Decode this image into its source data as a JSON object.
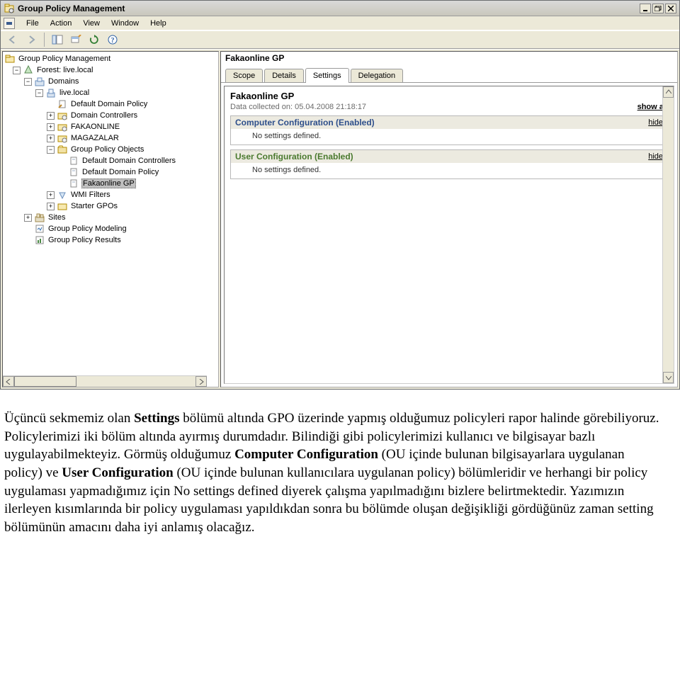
{
  "window": {
    "title": "Group Policy Management"
  },
  "menubar": [
    "File",
    "Action",
    "View",
    "Window",
    "Help"
  ],
  "tree": {
    "root": "Group Policy Management",
    "forest": "Forest: live.local",
    "domains": "Domains",
    "domain": "live.local",
    "items": [
      "Default Domain Policy",
      "Domain Controllers",
      "FAKAONLINE",
      "MAGAZALAR"
    ],
    "gpo_container": "Group Policy Objects",
    "gpos": [
      "Default Domain Controllers",
      "Default Domain Policy",
      "Fakaonline GP"
    ],
    "wmi": "WMI Filters",
    "starter": "Starter GPOs",
    "sites": "Sites",
    "modeling": "Group Policy Modeling",
    "results": "Group Policy Results"
  },
  "right": {
    "title": "Fakaonline GP",
    "tabs": [
      "Scope",
      "Details",
      "Settings",
      "Delegation"
    ],
    "report": {
      "title": "Fakaonline GP",
      "collected_label": "Data collected on:",
      "collected_value": "05.04.2008 21:18:17",
      "show_all": "show all",
      "sections": [
        {
          "name_key": "comp",
          "title": "Computer Configuration (Enabled)",
          "action": "hide",
          "body": "No settings defined."
        },
        {
          "name_key": "user",
          "title": "User Configuration (Enabled)",
          "action": "hide",
          "body": "No settings defined."
        }
      ]
    }
  },
  "article": {
    "p1a": "Üçüncü sekmemiz olan ",
    "p1b": "Settings",
    "p1c": " bölümü altında GPO üzerinde yapmış olduğumuz policyleri rapor halinde görebiliyoruz. Policylerimizi iki bölüm altında ayırmış durumdadır. Bilindiği gibi policylerimizi kullanıcı ve bilgisayar bazlı uygulayabilmekteyiz. Görmüş olduğumuz ",
    "p1d": "Computer Configuration",
    "p1e": " (OU içinde bulunan bilgisayarlara uygulanan policy) ve  ",
    "p1f": "User Configuration",
    "p1g": " (OU içinde bulunan kullanıcılara uygulanan policy) bölümleridir ve herhangi bir policy uygulaması yapmadığımız için No settings defined diyerek çalışma yapılmadığını bizlere belirtmektedir. Yazımızın ilerleyen kısımlarında bir policy uygulaması yapıldıkdan sonra bu bölümde oluşan değişikliği gördüğünüz zaman setting bölümünün amacını daha iyi anlamış olacağız."
  }
}
